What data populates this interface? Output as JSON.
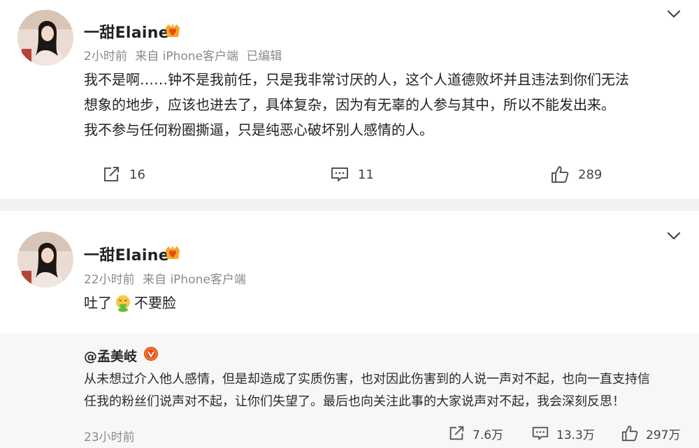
{
  "posts": [
    {
      "username": "一甜Elaine",
      "time": "2小时前",
      "source": "来自 iPhone客户端",
      "edited": "已编辑",
      "content_lines": [
        "我不是啊……钟不是我前任，只是我非常讨厌的人，这个人道德败坏并且违法到你们无法",
        "想象的地步，应该也进去了，具体复杂，因为有无辜的人参与其中，所以不能发出来。",
        "我不参与任何粉圈撕逼，只是纯恶心破坏别人感情的人。"
      ],
      "repost_count": "16",
      "comment_count": "11",
      "like_count": "289"
    },
    {
      "username": "一甜Elaine",
      "time": "22小时前",
      "source": "来自 iPhone客户端",
      "content_before": "吐了",
      "content_after": "不要脸",
      "repost": {
        "author": "@孟美岐",
        "content_lines": [
          "从未想过介入他人感情，但是却造成了实质伤害，也对因此伤害到的人说一声对不起，也向一直支持信",
          "任我的粉丝们说声对不起，让你们失望了。最后也向关注此事的大家说声对不起，我会深刻反思！"
        ],
        "time": "23小时前",
        "repost_count": "7.6万",
        "comment_count": "13.3万",
        "like_count": "297万"
      }
    }
  ],
  "icons": {
    "avatar": "avatar-photo",
    "badge": "crown-heart-icon",
    "verified": "verified-v-icon",
    "chevron": "chevron-down-icon",
    "repost": "repost-icon",
    "comment": "comment-icon",
    "like": "like-icon",
    "emoji": "vomit-emoji-icon"
  },
  "colors": {
    "accent_badge": "#f5a623",
    "verified": "#e8481b",
    "emoji_green": "#5fbf3a"
  }
}
